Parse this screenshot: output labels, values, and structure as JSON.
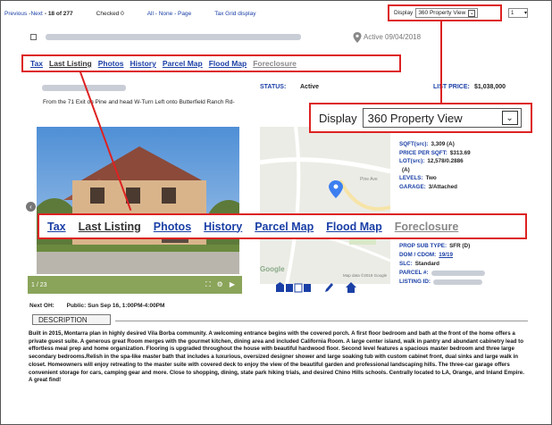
{
  "topnav": {
    "prev": "Previous",
    "sep1": " - ",
    "next": "Next",
    "of": "- 18 of 277",
    "checked": "Checked 0",
    "all_none_page": "All - None - Page",
    "tax_grid": "Tax Grid display",
    "display_label": "Display",
    "display_value": "360 Property View",
    "page_value": "1"
  },
  "listing": {
    "active_date": "Active 09/04/2018",
    "status_label": "STATUS:",
    "status_value": "Active",
    "list_price_label": "LIST PRICE:",
    "list_price_value": "$1,038,000",
    "directions": "From the 71 Exit on Pine and head W-Turn Left onto Butterfield Ranch Rd-"
  },
  "tabs": [
    {
      "label": "Tax",
      "style": "link"
    },
    {
      "label": "Last Listing",
      "style": "plain"
    },
    {
      "label": "Photos",
      "style": "link"
    },
    {
      "label": "History",
      "style": "link"
    },
    {
      "label": "Parcel Map",
      "style": "link"
    },
    {
      "label": "Flood Map",
      "style": "link"
    },
    {
      "label": "Foreclosure",
      "style": "grey"
    }
  ],
  "display_big": {
    "label": "Display",
    "value": "360 Property View"
  },
  "photo": {
    "counter": "1 / 23"
  },
  "map": {
    "google": "Google",
    "map_data": "Map data ©2018 Google",
    "road": "Pine Ave"
  },
  "details_top": [
    {
      "k": "SQFT(src):",
      "v": "3,309 (A)"
    },
    {
      "k": "PRICE PER SQFT:",
      "v": "$313.69"
    },
    {
      "k": "LOT(src):",
      "v": "12,578/0.2886"
    },
    {
      "k": "",
      "v": "(A)"
    },
    {
      "k": "LEVELS:",
      "v": "Two"
    },
    {
      "k": "GARAGE:",
      "v": "3/Attached"
    }
  ],
  "details_bottom": [
    {
      "k": "PROP SUB TYPE:",
      "v": "SFR (D)",
      "link": ""
    },
    {
      "k": "DOM / CDOM:",
      "v": "",
      "link": "19/19"
    },
    {
      "k": "SLC:",
      "v": "Standard",
      "link": ""
    },
    {
      "k": "PARCEL #:",
      "v": "",
      "link": ""
    },
    {
      "k": "LISTING ID:",
      "v": "",
      "link": ""
    }
  ],
  "open_house": {
    "label": "Next OH:",
    "value": "Public: Sun Sep 16, 1:00PM-4:00PM"
  },
  "description": {
    "tab": "DESCRIPTION",
    "text": "Built in 2015, Montarra plan in highly desired Vila Borba community. A welcoming entrance begins with the covered porch. A first floor bedroom and bath at the front of the home offers a private guest suite. A generous great Room merges with the gourmet kitchen, dining area and included California Room. A large center island, walk in pantry and abundant cabinetry lead to effortless meal prep and home organization. Flooring is upgraded throughout the house with beautiful hardwood floor. Second level features a spacious master bedroom and three large secondary bedrooms.Relish in the spa-like master bath that includes a luxurious, oversized designer shower and large soaking tub with custom cabinet front, dual sinks and large walk in closet. Homeowners will enjoy retreating to the master suite with covered deck to enjoy the view of the beautiful garden and professional landscaping hills. The three-car garage offers convenient storage for cars, camping gear and more. Close to shopping, dining, state park hiking trials, and desired Chino Hills schools. Centrally located to LA, Orange, and Inland Empire. A great find!"
  },
  "colors": {
    "highlight": "#dd2222",
    "link": "#1a3fa6"
  }
}
